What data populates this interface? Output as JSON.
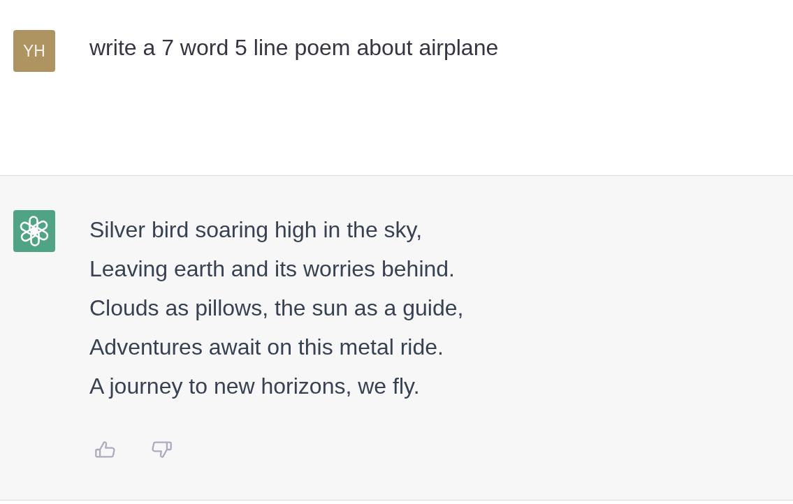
{
  "messages": [
    {
      "kind": "user",
      "initials": "YH",
      "text": "write a 7 word 5 line poem about airplane"
    },
    {
      "kind": "assistant",
      "lines": [
        "Silver bird soaring high in the sky,",
        "Leaving earth and its worries behind.",
        "Clouds as pillows, the sun as a guide,",
        "Adventures await on this metal ride.",
        "A journey to new horizons, we fly."
      ]
    }
  ]
}
